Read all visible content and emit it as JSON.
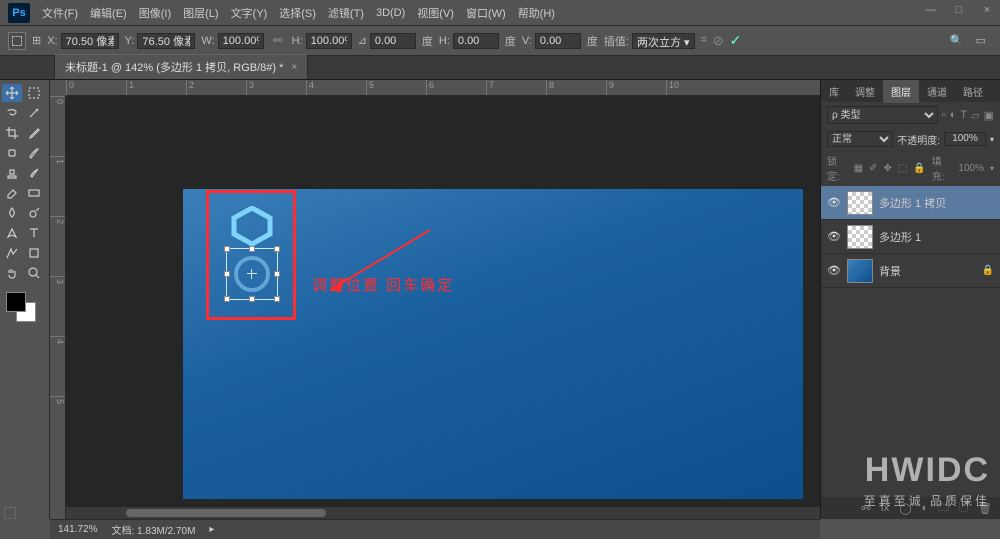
{
  "app": {
    "badge": "Ps"
  },
  "menu": [
    "文件(F)",
    "编辑(E)",
    "图像(I)",
    "图层(L)",
    "文字(Y)",
    "选择(S)",
    "滤镜(T)",
    "3D(D)",
    "视图(V)",
    "窗口(W)",
    "帮助(H)"
  ],
  "win": {
    "min": "—",
    "max": "□",
    "close": "×"
  },
  "options": {
    "x_label": "X:",
    "x": "70.50 像素",
    "y_label": "Y:",
    "y": "76.50 像素",
    "w_label": "W:",
    "w": "100.00%",
    "h_label": "H:",
    "h": "100.00%",
    "angle_label": "⊿",
    "angle": "0.00",
    "skew_h_label": "H:",
    "skew_h": "0.00",
    "skew_h_unit": "度",
    "skew_v_label": "V:",
    "skew_v": "0.00",
    "skew_v_unit": "度",
    "interp_label": "插值:",
    "interp": "两次立方 ▾"
  },
  "doc": {
    "tab": "未标题-1 @ 142% (多边形 1 拷贝, RGB/8#) *"
  },
  "rulers": {
    "h": [
      "0",
      "1",
      "2",
      "3",
      "4",
      "5",
      "6",
      "7",
      "8",
      "9",
      "10"
    ],
    "v": [
      "0",
      "1",
      "2",
      "3",
      "4",
      "5"
    ]
  },
  "annot": {
    "text": "调整位置  回车确定"
  },
  "panels": {
    "tabs": [
      "库",
      "调整",
      "图层",
      "通道",
      "路径"
    ],
    "active_tab": 2,
    "search": "ρ 类型",
    "blend": "正常",
    "opacity_label": "不透明度:",
    "opacity": "100%",
    "lock_label": "锁定:",
    "fill_label": "填充:",
    "fill": "100%",
    "layers": [
      {
        "name": "多边形 1 拷贝",
        "sel": true,
        "thumb": "checker"
      },
      {
        "name": "多边形 1",
        "sel": false,
        "thumb": "checker"
      },
      {
        "name": "背景",
        "sel": false,
        "thumb": "grad",
        "locked": true
      }
    ]
  },
  "status": {
    "zoom": "141.72%",
    "docinfo": "文档: 1.83M/2.70M"
  },
  "watermark": {
    "line1": "HWIDC",
    "line2": "至真至诚 品质保佳"
  }
}
